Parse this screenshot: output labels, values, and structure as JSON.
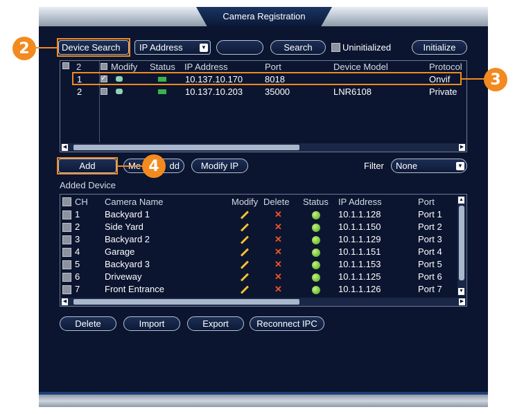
{
  "window": {
    "title": "Camera Registration"
  },
  "toolbar": {
    "device_search": "Device Search",
    "ip_address_select": "IP Address",
    "search": "Search",
    "uninitialized": "Uninitialized",
    "initialize": "Initialize"
  },
  "search_table": {
    "count": "2",
    "columns": [
      "Modify",
      "Status",
      "IP Address",
      "Port",
      "Device Model",
      "Protocol"
    ],
    "rows": [
      {
        "no": "1",
        "ip": "10.137.10.170",
        "port": "8018",
        "model": "",
        "protocol": "Onvif"
      },
      {
        "no": "2",
        "ip": "10.137.10.203",
        "port": "35000",
        "model": "LNR6108",
        "protocol": "Private"
      }
    ]
  },
  "actions": {
    "add": "Add",
    "manual_add_prefix": "Me",
    "manual_add_suffix": "dd",
    "modify_ip": "Modify IP",
    "filter_label": "Filter",
    "filter_value": "None"
  },
  "added_device": {
    "title": "Added Device",
    "columns": [
      "CH",
      "Camera Name",
      "Modify",
      "Delete",
      "Status",
      "IP Address",
      "Port"
    ],
    "rows": [
      {
        "ch": "1",
        "name": "Backyard 1",
        "ip": "10.1.1.128",
        "port": "Port 1"
      },
      {
        "ch": "2",
        "name": "Side Yard",
        "ip": "10.1.1.150",
        "port": "Port 2"
      },
      {
        "ch": "3",
        "name": "Backyard 2",
        "ip": "10.1.1.129",
        "port": "Port 3"
      },
      {
        "ch": "4",
        "name": "Garage",
        "ip": "10.1.1.151",
        "port": "Port 4"
      },
      {
        "ch": "5",
        "name": "Backyard 3",
        "ip": "10.1.1.153",
        "port": "Port 5"
      },
      {
        "ch": "6",
        "name": "Driveway",
        "ip": "10.1.1.125",
        "port": "Port 6"
      },
      {
        "ch": "7",
        "name": "Front Entrance",
        "ip": "10.1.1.126",
        "port": "Port 7"
      }
    ]
  },
  "bottom_buttons": {
    "delete": "Delete",
    "import": "Import",
    "export": "Export",
    "reconnect": "Reconnect IPC"
  },
  "callouts": {
    "b2": "2",
    "b3": "3",
    "b4": "4"
  },
  "colors": {
    "highlight": "#f28a1f",
    "background": "#0b1530"
  },
  "icons": [
    "dropdown-arrow-icon",
    "checkbox-icon",
    "modify-icon",
    "network-status-icon",
    "edit-pencil-icon",
    "delete-x-icon",
    "online-status-icon",
    "scroll-arrow-icon"
  ]
}
